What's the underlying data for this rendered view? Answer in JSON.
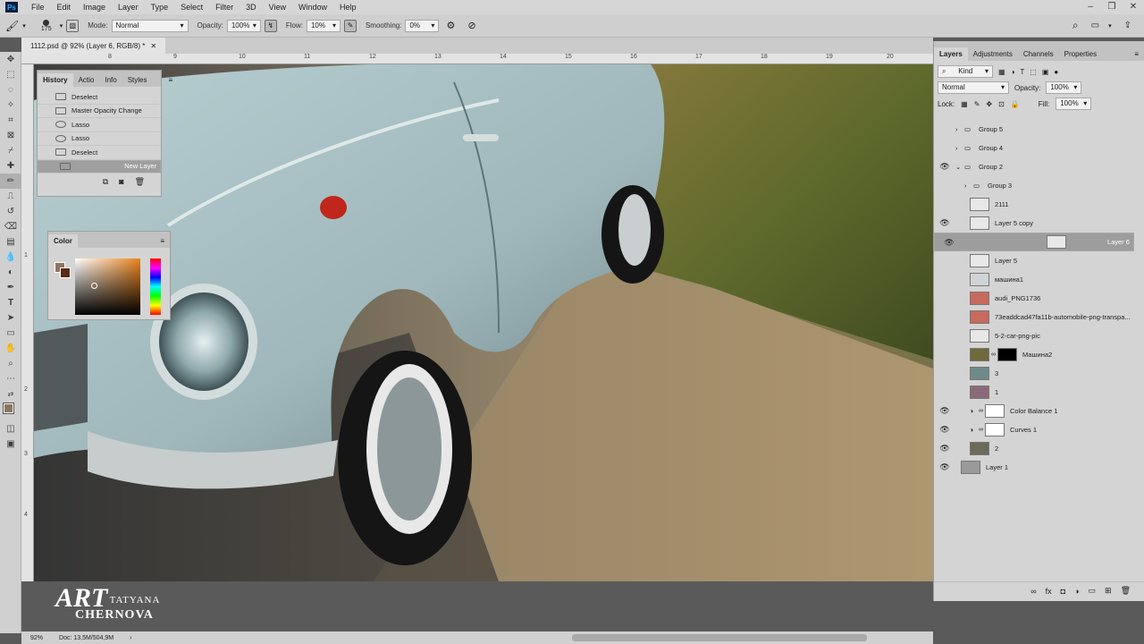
{
  "menubar": {
    "app_icon": "Ps",
    "items": [
      "File",
      "Edit",
      "Image",
      "Layer",
      "Type",
      "Select",
      "Filter",
      "3D",
      "View",
      "Window",
      "Help"
    ]
  },
  "options": {
    "brush_size": "175",
    "mode_label": "Mode:",
    "mode_value": "Normal",
    "opacity_label": "Opacity:",
    "opacity_value": "100%",
    "flow_label": "Flow:",
    "flow_value": "10%",
    "smoothing_label": "Smoothing:",
    "smoothing_value": "0%"
  },
  "document": {
    "tab_title": "1112.psd @ 92% (Layer 6, RGB/8) *",
    "ruler_h": [
      "8",
      "9",
      "10",
      "11",
      "12",
      "13",
      "14",
      "15",
      "16",
      "17",
      "18",
      "19",
      "20"
    ],
    "ruler_v": [
      "1",
      "2",
      "3",
      "4"
    ]
  },
  "history": {
    "tabs": [
      "History",
      "Actio",
      "Info",
      "Styles"
    ],
    "items": [
      {
        "label": "Deselect"
      },
      {
        "label": "Master Opacity Change"
      },
      {
        "label": "Lasso"
      },
      {
        "label": "Lasso"
      },
      {
        "label": "Deselect"
      },
      {
        "label": "New Layer"
      }
    ]
  },
  "color_panel": {
    "title": "Color"
  },
  "layers_panel": {
    "tabs": [
      "Layers",
      "Adjustments",
      "Channels",
      "Properties"
    ],
    "kind_filter": "Kind",
    "blend_mode": "Normal",
    "opacity_label": "Opacity:",
    "opacity_value": "100%",
    "lock_label": "Lock:",
    "fill_label": "Fill:",
    "fill_value": "100%",
    "layers": [
      {
        "name": "Group 5",
        "type": "group",
        "visible": false
      },
      {
        "name": "Group 4",
        "type": "group",
        "visible": false
      },
      {
        "name": "Group 2",
        "type": "group",
        "visible": true
      },
      {
        "name": "Group 3",
        "type": "group",
        "visible": false
      },
      {
        "name": "2111",
        "type": "layer",
        "visible": false
      },
      {
        "name": "Layer 5 copy",
        "type": "layer",
        "visible": true
      },
      {
        "name": "Layer 6",
        "type": "layer",
        "visible": true,
        "selected": true
      },
      {
        "name": "Layer 5",
        "type": "layer",
        "visible": false
      },
      {
        "name": "машина1",
        "type": "layer",
        "visible": false
      },
      {
        "name": "audi_PNG1736",
        "type": "layer",
        "visible": false
      },
      {
        "name": "73eaddcad47fa11b-automobile-png-transpa...",
        "type": "layer",
        "visible": false
      },
      {
        "name": "5-2-car-png-pic",
        "type": "layer",
        "visible": false
      },
      {
        "name": "Машина2",
        "type": "layer",
        "visible": false
      },
      {
        "name": "3",
        "type": "layer",
        "visible": false
      },
      {
        "name": "1",
        "type": "layer",
        "visible": false
      },
      {
        "name": "Color Balance 1",
        "type": "adjustment",
        "visible": true
      },
      {
        "name": "Curves 1",
        "type": "adjustment",
        "visible": true
      },
      {
        "name": "2",
        "type": "layer",
        "visible": true
      },
      {
        "name": "Layer 1",
        "type": "layer",
        "visible": true
      }
    ]
  },
  "status": {
    "zoom": "92%",
    "doc": "Doc: 13,5M/504,9M"
  },
  "watermark": {
    "art": "ART",
    "first": "TATYANA",
    "last": "CHERNOVA"
  },
  "colors": {
    "ui_bg": "#d4d4d4",
    "selected_row": "#9d9d9d",
    "car_paint": "#a9c2c6",
    "tail_light": "#c0261b"
  }
}
